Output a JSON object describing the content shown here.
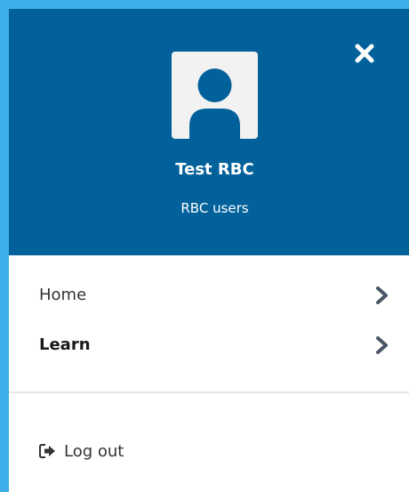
{
  "header": {
    "user_name": "Test RBC",
    "user_group": "RBC users",
    "avatar_icon": "user-avatar-icon",
    "close_icon": "close-icon"
  },
  "nav": {
    "items": [
      {
        "label": "Home",
        "icon": "chevron-right-icon"
      },
      {
        "label": "Learn",
        "icon": "chevron-right-icon"
      }
    ]
  },
  "logout": {
    "label": "Log out",
    "icon": "sign-out-icon"
  },
  "colors": {
    "page_border": "#3eaee8",
    "header_bg": "#02619b",
    "text": "#333333",
    "chevron": "#4a5565"
  }
}
